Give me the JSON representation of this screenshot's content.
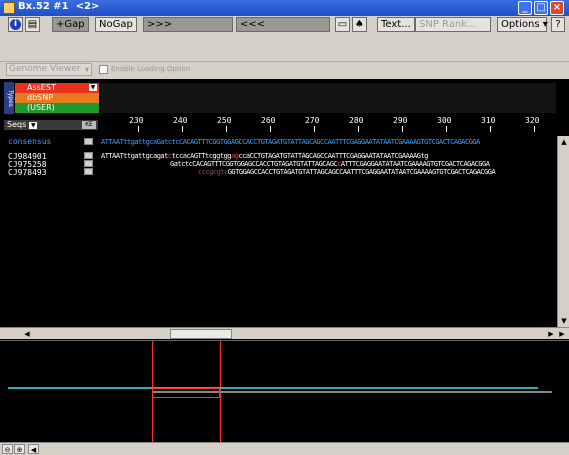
{
  "window": {
    "title": "Bx.52 #1  <2>"
  },
  "toolbar": {
    "gap_label": "+Gap",
    "nogap_label": "NoGap",
    "next_label": ">>>",
    "prev_label": "<<<",
    "text_label": "Text...",
    "snp_rank_label": "SNP Rank...",
    "options_label": "Options",
    "help_label": "?"
  },
  "viewer": {
    "selected": "Genome Viewer",
    "enable_loading_label": "Enable Loading Option"
  },
  "features": {
    "side_label": "Types",
    "tracks": [
      {
        "label": "AssEST",
        "color": "#e8321e"
      },
      {
        "label": "dbSNP",
        "color": "#e87a1e"
      },
      {
        "label": "(USER)",
        "color": "#1e9a2a"
      }
    ]
  },
  "sequences": {
    "header": "Seqs",
    "ruler": [
      "230",
      "240",
      "250",
      "260",
      "270",
      "280",
      "290",
      "300",
      "310",
      "320"
    ],
    "rows": [
      {
        "name": "consensus",
        "seq": "ATTAATttgattgcaGatctcCACAGTTTCGGTGGAGCCACCTGTAGATGTATTAGCAGCCAATTTCGAGGAATATAATCGAAAAGTGTCGACTCAGACGGA"
      },
      {
        "name": "CJ984901",
        "seq_a": "ATTAATttgattgcagat",
        "seq_b": "c",
        "seq_c": "tccacAGTTtcggtgg",
        "seq_d": "ag",
        "seq_e": "ccaCCTGTAGATGTATTAGCAGCCAATTTCGAGGAATATAATCGAAAAGtg"
      },
      {
        "name": "CJ975258",
        "seq_a": "GatctcCACAGTTTCGGTGGAGCCACCTGTAGATGTATTAGCAGC",
        "seq_b": "c",
        "seq_c": "ATTTCGAGGAATATAATCGAAAAGTGTCGACTCAGACGGA"
      },
      {
        "name": "CJ978493",
        "seq_a": "cccgcgtc",
        "seq_b": "GGTGGAGCCACCTGTAGATGTATTAGCAGCCAATTTCGAGGAATATAATCGAAAAGTGTCGACTCAGACGGA"
      }
    ]
  }
}
